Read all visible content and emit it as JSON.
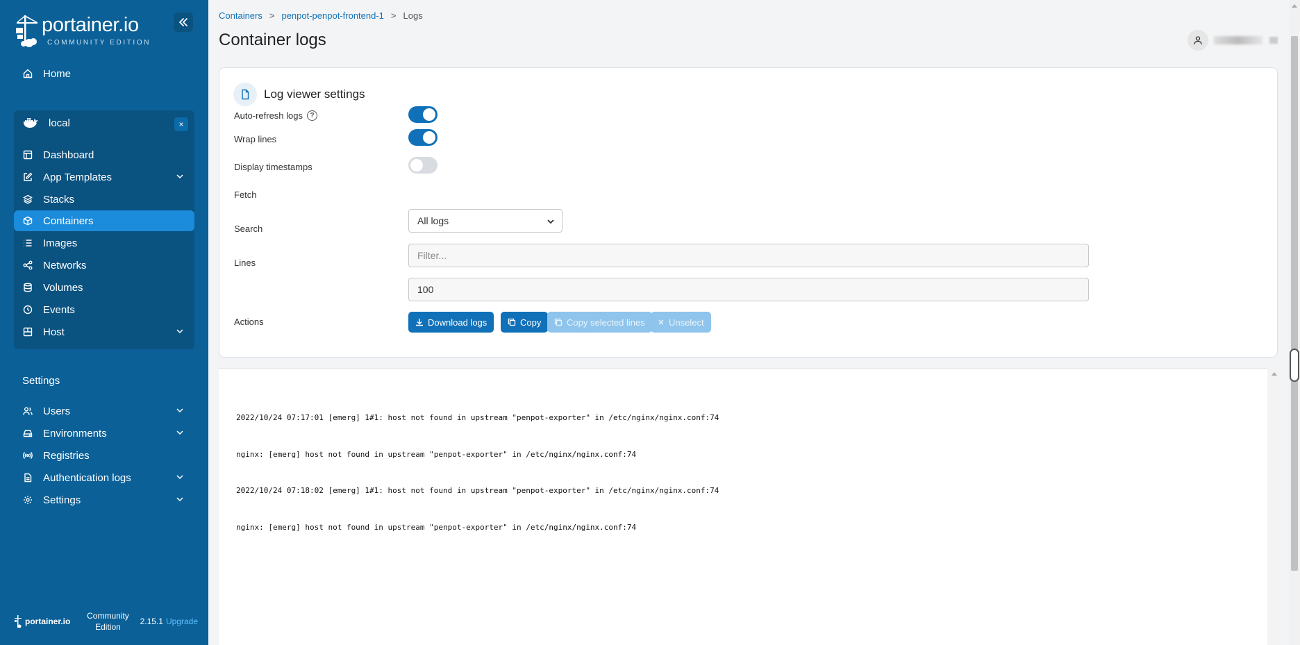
{
  "brand": {
    "logo_text": "portainer.io",
    "logo_sub": "COMMUNITY EDITION"
  },
  "sidebar": {
    "home": "Home",
    "environment": {
      "name": "local",
      "close": "×"
    },
    "env_items": [
      {
        "label": "Dashboard",
        "icon": "dashboard-icon"
      },
      {
        "label": "App Templates",
        "icon": "edit-icon",
        "expandable": true
      },
      {
        "label": "Stacks",
        "icon": "layers-icon"
      },
      {
        "label": "Containers",
        "icon": "box-icon",
        "active": true
      },
      {
        "label": "Images",
        "icon": "list-icon"
      },
      {
        "label": "Networks",
        "icon": "share-icon"
      },
      {
        "label": "Volumes",
        "icon": "database-icon"
      },
      {
        "label": "Events",
        "icon": "clock-icon"
      },
      {
        "label": "Host",
        "icon": "host-icon",
        "expandable": true
      }
    ],
    "settings_heading": "Settings",
    "settings_items": [
      {
        "label": "Users",
        "icon": "users-icon",
        "expandable": true
      },
      {
        "label": "Environments",
        "icon": "hdd-icon",
        "expandable": true
      },
      {
        "label": "Registries",
        "icon": "radio-icon"
      },
      {
        "label": "Authentication logs",
        "icon": "file-icon",
        "expandable": true
      },
      {
        "label": "Settings",
        "icon": "gear-icon",
        "expandable": true
      }
    ],
    "footer": {
      "brand": "portainer.io",
      "edition": "Community Edition",
      "version": "2.15.1",
      "upgrade": "Upgrade"
    }
  },
  "breadcrumb": {
    "items": [
      "Containers",
      "penpot-penpot-frontend-1",
      "Logs"
    ],
    "separator": ">"
  },
  "page_title": "Container logs",
  "settings_card": {
    "title": "Log viewer settings",
    "auto_refresh_label": "Auto-refresh logs",
    "auto_refresh_help": "?",
    "auto_refresh": true,
    "wrap_lines_label": "Wrap lines",
    "wrap_lines": true,
    "timestamps_label": "Display timestamps",
    "timestamps": false,
    "fetch_label": "Fetch",
    "fetch_value": "All logs",
    "search_label": "Search",
    "search_placeholder": "Filter...",
    "lines_label": "Lines",
    "lines_value": "100",
    "actions_label": "Actions",
    "download_label": "Download logs",
    "copy_label": "Copy",
    "copy_selected_label": "Copy selected lines",
    "unselect_label": "Unselect"
  },
  "logs": [
    "2022/10/24 07:17:01 [emerg] 1#1: host not found in upstream \"penpot-exporter\" in /etc/nginx/nginx.conf:74",
    "nginx: [emerg] host not found in upstream \"penpot-exporter\" in /etc/nginx/nginx.conf:74",
    "2022/10/24 07:18:02 [emerg] 1#1: host not found in upstream \"penpot-exporter\" in /etc/nginx/nginx.conf:74",
    "nginx: [emerg] host not found in upstream \"penpot-exporter\" in /etc/nginx/nginx.conf:74"
  ],
  "colors": {
    "sidebar_bg": "#0b6097",
    "active_item": "#1b8bdb",
    "primary": "#1171b8"
  }
}
